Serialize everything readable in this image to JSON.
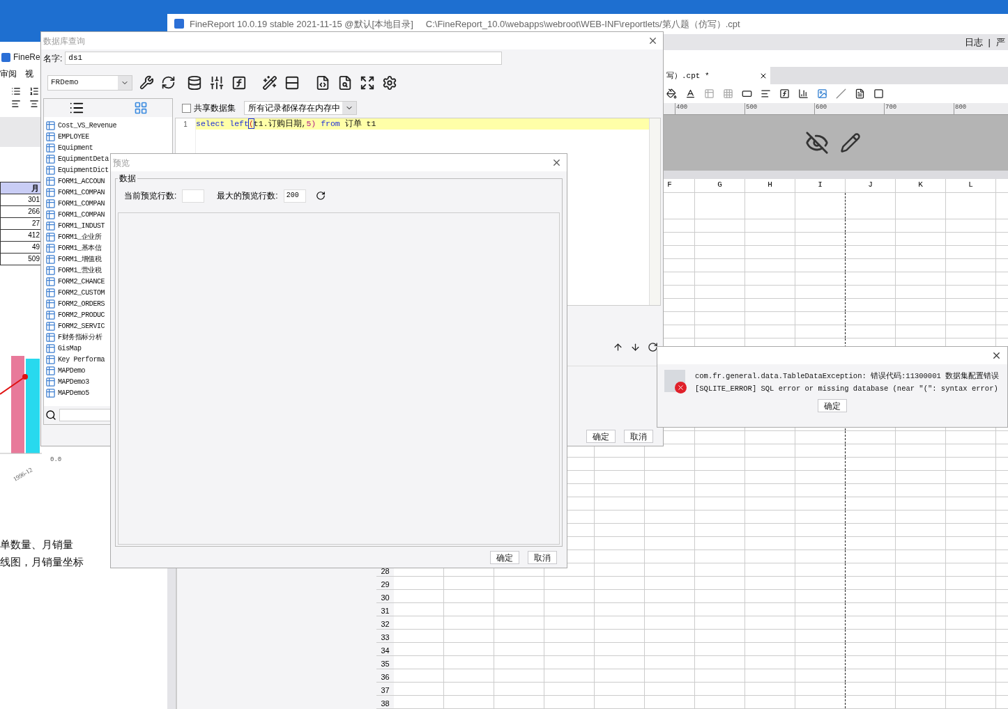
{
  "main_window": {
    "title": "FineReport 10.0.19 stable 2021-11-15 @默认[本地目录]",
    "path": "C:\\FineReport_10.0\\webapps\\webroot\\WEB-INF\\reportlets/第八题（仿写）.cpt",
    "menu_right": [
      "日志",
      "|",
      "严"
    ],
    "tab": {
      "label": "写）.cpt *"
    },
    "ruler_ticks": [
      "400",
      "500",
      "600",
      "700",
      "800"
    ],
    "columns": [
      "F",
      "G",
      "H",
      "I",
      "J",
      "K",
      "L"
    ],
    "row_numbers": [
      "28",
      "29",
      "30",
      "31",
      "32",
      "33",
      "34",
      "35",
      "36",
      "37",
      "38"
    ]
  },
  "background_document": {
    "app_title": "FineRe",
    "menu": [
      "审阅",
      "视"
    ],
    "table_header": "月",
    "table_values": [
      "301",
      "266",
      "27",
      "412",
      "49",
      "509"
    ],
    "chart_y_label": "0.0",
    "chart_x_label": "1996-12",
    "lines": [
      "单数量、月销量",
      "线图，月销量坐标"
    ]
  },
  "query_dialog": {
    "title": "数据库查询",
    "name_label": "名字:",
    "name_value": "ds1",
    "connection": "FRDemo",
    "tables": [
      "Cost_VS_Revenue",
      "EMPLOYEE",
      "Equipment",
      "EquipmentDeta",
      "EquipmentDict",
      "FORM1_ACCOUN",
      "FORM1_COMPAN",
      "FORM1_COMPAN",
      "FORM1_COMPAN",
      "FORM1_INDUST",
      "FORM1_企业所",
      "FORM1_基本信",
      "FORM1_增值税",
      "FORM1_营业税",
      "FORM2_CHANCE",
      "FORM2_CUSTOM",
      "FORM2_ORDERS",
      "FORM2_PRODUC",
      "FORM2_SERVIC",
      "F财务指标分析",
      "GisMap",
      "Key Performa",
      "MAPDemo",
      "MAPDemo3",
      "MAPDemo5"
    ],
    "share_dataset": {
      "label": "共享数据集",
      "checked": false
    },
    "storage_mode": "所有记录都保存在内存中",
    "code_lines": [
      {
        "number": "1",
        "tokens": [
          {
            "text": "select left",
            "kind": "keyword"
          },
          {
            "text": "(",
            "kind": "bracket"
          },
          {
            "text": "t1.订购日期,",
            "kind": "plain"
          },
          {
            "text": "5)",
            "kind": "number"
          },
          {
            "text": " from",
            "kind": "keyword"
          },
          {
            "text": " 订单 t1",
            "kind": "plain"
          }
        ]
      }
    ],
    "buttons": [
      "确定",
      "取消"
    ]
  },
  "preview_dialog": {
    "title": "预览",
    "group": "数据",
    "current_rows_label": "当前预览行数:",
    "max_rows_label": "最大的预览行数:",
    "max_rows_value": "200",
    "buttons": [
      "确定",
      "取消"
    ]
  },
  "error_dialog": {
    "lines": [
      "com.fr.general.data.TableDataException: 错误代码:11300001 数据集配置错误",
      "[SQLITE_ERROR] SQL error or missing database (near \"(\": syntax error)"
    ],
    "button": "确定"
  }
}
